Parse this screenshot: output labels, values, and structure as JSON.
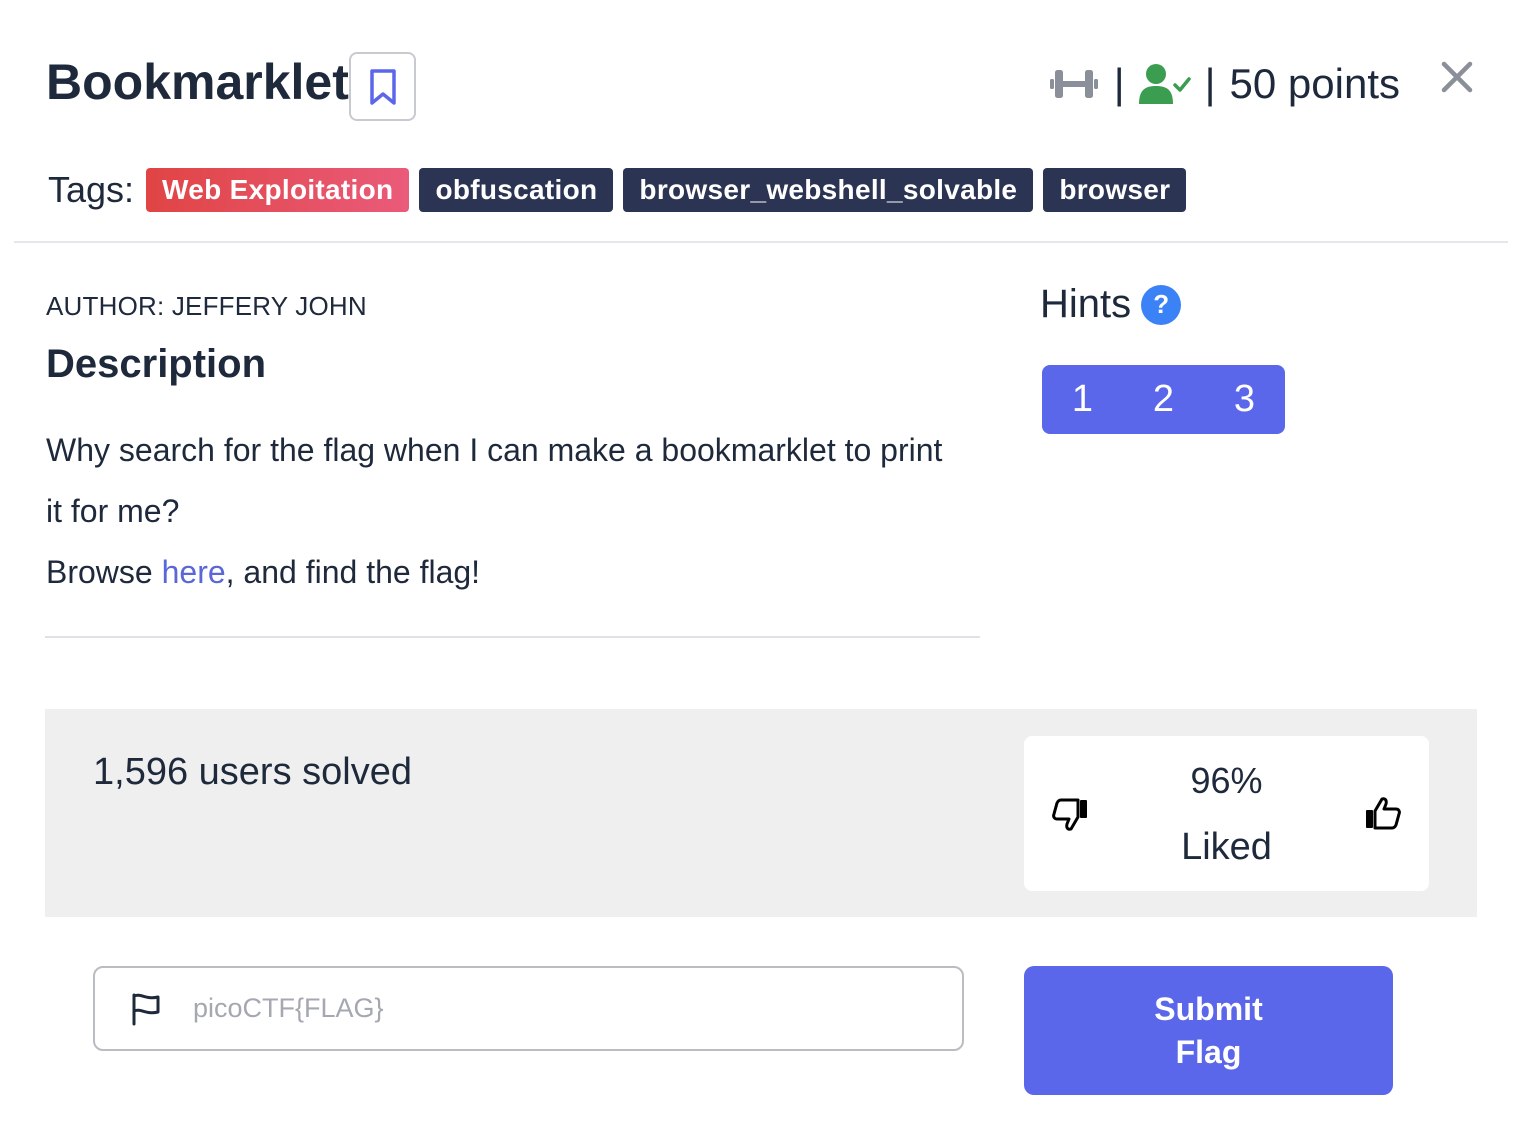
{
  "challenge": {
    "title": "Bookmarklet",
    "points_label": "50 points",
    "separator": "|"
  },
  "tags": {
    "label": "Tags:",
    "items": [
      "Web Exploitation",
      "obfuscation",
      "browser_webshell_solvable",
      "browser"
    ]
  },
  "author": "AUTHOR: JEFFERY JOHN",
  "description": {
    "heading": "Description",
    "line1": "Why search for the flag when I can make a bookmarklet to print it for me?",
    "line2_prefix": "Browse ",
    "line2_link": "here",
    "line2_suffix": ", and find the flag!"
  },
  "hints": {
    "heading": "Hints",
    "help_glyph": "?",
    "buttons": [
      "1",
      "2",
      "3"
    ]
  },
  "stats": {
    "solved": "1,596 users solved",
    "liked_percent": "96%",
    "liked_label": "Liked"
  },
  "flag_form": {
    "placeholder": "picoCTF{FLAG}",
    "value": "",
    "submit_label": "Submit Flag"
  },
  "colors": {
    "accent": "#5b67ea",
    "tag_dark": "#2b3452",
    "tag_web_start": "#e04444",
    "tag_web_end": "#ea5b7a",
    "solved_green": "#3a9d4f",
    "link": "#5a67d8"
  },
  "icons": {
    "bookmark": "bookmark-icon",
    "difficulty": "dumbbell-icon",
    "solved_status": "user-check-icon",
    "close": "close-icon",
    "help": "help-icon",
    "thumbs_down": "thumbs-down-icon",
    "thumbs_up": "thumbs-up-icon",
    "flag": "flag-icon"
  }
}
